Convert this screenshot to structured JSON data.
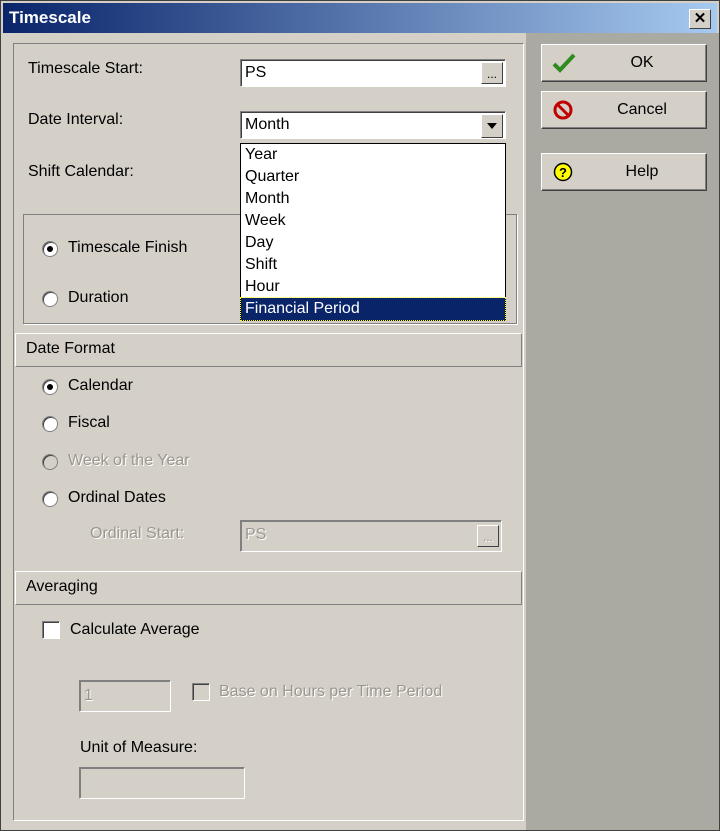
{
  "window": {
    "title": "Timescale",
    "close_symbol": "✕"
  },
  "buttons": {
    "ok": "OK",
    "cancel": "Cancel",
    "help": "Help"
  },
  "timescale_start": {
    "label": "Timescale Start:",
    "value": "PS",
    "browse": "..."
  },
  "date_interval": {
    "label": "Date Interval:",
    "value": "Month",
    "options": [
      "Year",
      "Quarter",
      "Month",
      "Week",
      "Day",
      "Shift",
      "Hour",
      "Financial Period"
    ],
    "highlighted": "Financial Period"
  },
  "shift_calendar": {
    "label": "Shift Calendar:"
  },
  "finish_group": {
    "timescale_finish": "Timescale Finish",
    "duration": "Duration"
  },
  "date_format": {
    "header": "Date Format",
    "calendar": "Calendar",
    "fiscal": "Fiscal",
    "week_of_year": "Week of the Year",
    "ordinal_dates": "Ordinal Dates",
    "ordinal_start_label": "Ordinal Start:",
    "ordinal_start_value": "PS",
    "browse": "..."
  },
  "averaging": {
    "header": "Averaging",
    "calculate_average": "Calculate Average",
    "count_value": "1",
    "base_on_hours": "Base on Hours per Time Period",
    "unit_label": "Unit of Measure:",
    "unit_value": ""
  },
  "colors": {
    "title_start": "#0a246a",
    "title_end": "#a6caf0",
    "selection": "#0a246a",
    "ok_icon": "#2e8b1f",
    "cancel_icon": "#c00000",
    "help_icon": "#ffff00"
  },
  "icons": {
    "ok": "checkmark-icon",
    "cancel": "no-entry-icon",
    "help": "question-icon"
  }
}
